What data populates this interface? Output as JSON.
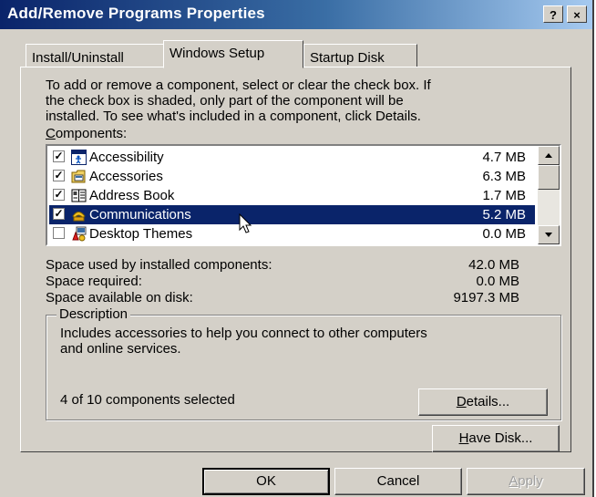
{
  "window": {
    "title": "Add/Remove Programs Properties",
    "help_btn": "?",
    "close_btn": "×"
  },
  "tabs": [
    {
      "label": "Install/Uninstall",
      "active": false
    },
    {
      "label": "Windows Setup",
      "active": true
    },
    {
      "label": "Startup Disk",
      "active": false
    }
  ],
  "instructions": [
    "To add or remove a component, select or clear the check box. If",
    "the check box is shaded, only part of the component will be",
    "installed. To see what's included in a component, click Details."
  ],
  "components_label": "Components:",
  "components": [
    {
      "name": "Accessibility",
      "size": "4.7 MB",
      "checked": true,
      "icon": "accessibility-icon"
    },
    {
      "name": "Accessories",
      "size": "6.3 MB",
      "checked": true,
      "icon": "accessories-icon"
    },
    {
      "name": "Address Book",
      "size": "1.7 MB",
      "checked": true,
      "icon": "address-book-icon"
    },
    {
      "name": "Communications",
      "size": "5.2 MB",
      "checked": true,
      "icon": "communications-icon",
      "selected": true
    },
    {
      "name": "Desktop Themes",
      "size": "0.0 MB",
      "checked": false,
      "icon": "desktop-themes-icon"
    }
  ],
  "space": [
    {
      "label": "Space used by installed components:",
      "value": "42.0 MB"
    },
    {
      "label": "Space required:",
      "value": "0.0 MB"
    },
    {
      "label": "Space available on disk:",
      "value": "9197.3 MB"
    }
  ],
  "description": {
    "legend": "Description",
    "lines": [
      "Includes accessories to help you connect to other computers",
      "and online services."
    ],
    "count": "4 of 10 components selected",
    "details_button": "Details..."
  },
  "have_disk_button": "Have Disk...",
  "buttons": {
    "ok": "OK",
    "cancel": "Cancel",
    "apply": "Apply"
  }
}
